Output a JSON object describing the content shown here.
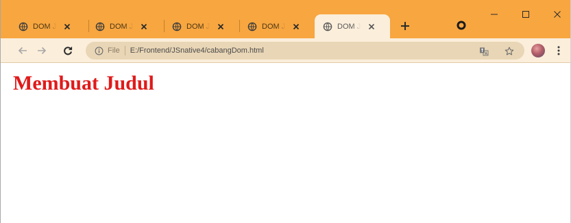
{
  "browser": {
    "tabs": [
      {
        "title": "DOM J",
        "active": false
      },
      {
        "title": "DOM J",
        "active": false
      },
      {
        "title": "DOM J",
        "active": false
      },
      {
        "title": "DOM J",
        "active": false
      },
      {
        "title": "DOM J",
        "active": true
      }
    ],
    "new_tab_label": "+",
    "window_controls": {
      "minimize": "–",
      "maximize": "☐",
      "close": "✕"
    },
    "icons": {
      "tab_favicon": "globe-icon",
      "tab_close": "close-icon",
      "back": "back-arrow-icon",
      "forward": "forward-arrow-icon",
      "reload": "reload-icon",
      "info": "info-icon",
      "translate": "translate-icon",
      "bookmark": "star-icon",
      "menu": "kebab-menu-icon"
    },
    "colors": {
      "tabstrip": "#f7a640",
      "toolbar": "#fbeedb",
      "omnibox": "#e9d6b6",
      "heading": "#e01a1a"
    }
  },
  "address_bar": {
    "scheme_label": "File",
    "url": "E:/Frontend/JSnative4/cabangDom.html"
  },
  "page": {
    "heading": "Membuat Judul"
  }
}
